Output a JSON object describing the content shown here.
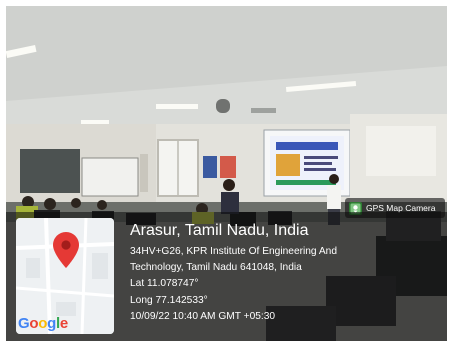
{
  "gps_badge": {
    "label": "GPS Map Camera",
    "icon": "gps-map-camera-icon"
  },
  "map": {
    "brand": "Google",
    "icon": "map-pin-icon",
    "pin_color": "#e53935"
  },
  "location": {
    "title": "Arasur, Tamil Nadu, India",
    "address_line1": "34HV+G26, KPR Institute Of Engineering And",
    "address_line2": "Technology, Tamil Nadu 641048, India",
    "lat": "Lat 11.078747°",
    "long": "Long 77.142533°",
    "timestamp": "10/09/22 10:40 AM GMT +05:30"
  }
}
